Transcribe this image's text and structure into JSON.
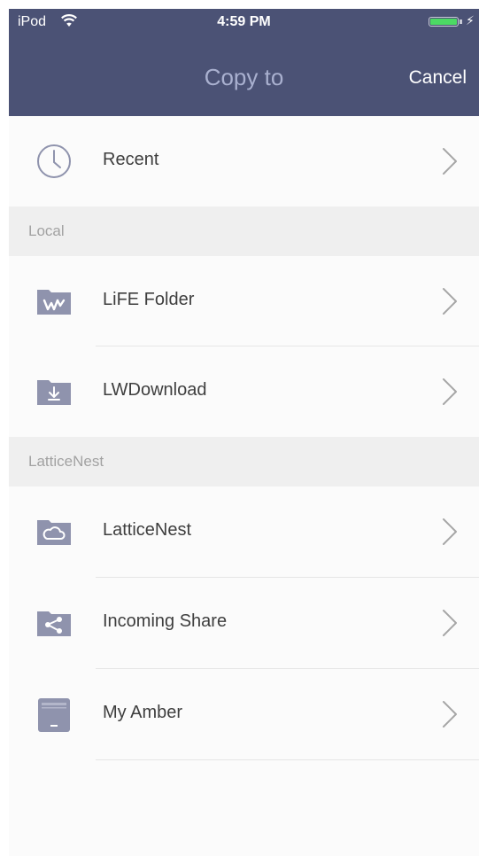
{
  "status_bar": {
    "carrier": "iPod",
    "time": "4:59 PM"
  },
  "header": {
    "title": "Copy to",
    "cancel_label": "Cancel"
  },
  "recent": {
    "label": "Recent",
    "icon": "clock-icon"
  },
  "sections": [
    {
      "title": "Local",
      "items": [
        {
          "label": "LiFE Folder",
          "icon": "life-folder-icon"
        },
        {
          "label": "LWDownload",
          "icon": "download-folder-icon"
        }
      ]
    },
    {
      "title": "LatticeNest",
      "items": [
        {
          "label": "LatticeNest",
          "icon": "cloud-folder-icon"
        },
        {
          "label": "Incoming Share",
          "icon": "share-folder-icon"
        },
        {
          "label": "My Amber",
          "icon": "device-icon"
        }
      ]
    }
  ],
  "colors": {
    "nav_background": "#4b5275",
    "nav_title": "#a9b0cf",
    "icon_color": "#8f93ad",
    "section_background": "#efefef",
    "battery": "#4cd964"
  }
}
